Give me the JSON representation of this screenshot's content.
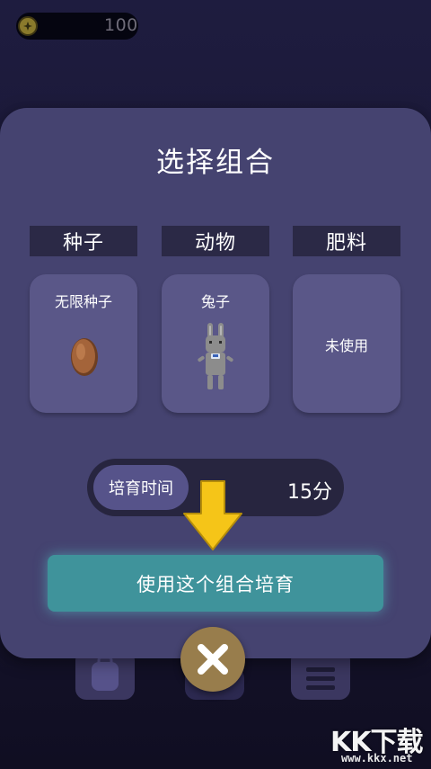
{
  "hud": {
    "coin_icon": "coin-icon",
    "coins": "100"
  },
  "modal": {
    "title": "选择组合",
    "columns": [
      {
        "header": "种子",
        "item": "无限种子",
        "art": "seed-icon"
      },
      {
        "header": "动物",
        "item": "兔子",
        "art": "rabbit-icon"
      },
      {
        "header": "肥料",
        "item": "未使用",
        "art": ""
      }
    ],
    "time_label": "培育时间",
    "time_value": "15分",
    "action_label": "使用这个组合培育",
    "close_icon": "close-icon"
  },
  "hint_icon": "arrow-down-icon",
  "watermark": {
    "logo": "KK下载",
    "url": "www.kkx.net"
  },
  "colors": {
    "modal_bg": "#454370",
    "card_bg": "#5a5788",
    "header_bg": "#2b2946",
    "action_bg": "#3f939b",
    "close_bg": "#987d4c",
    "arrow": "#f5c518"
  }
}
